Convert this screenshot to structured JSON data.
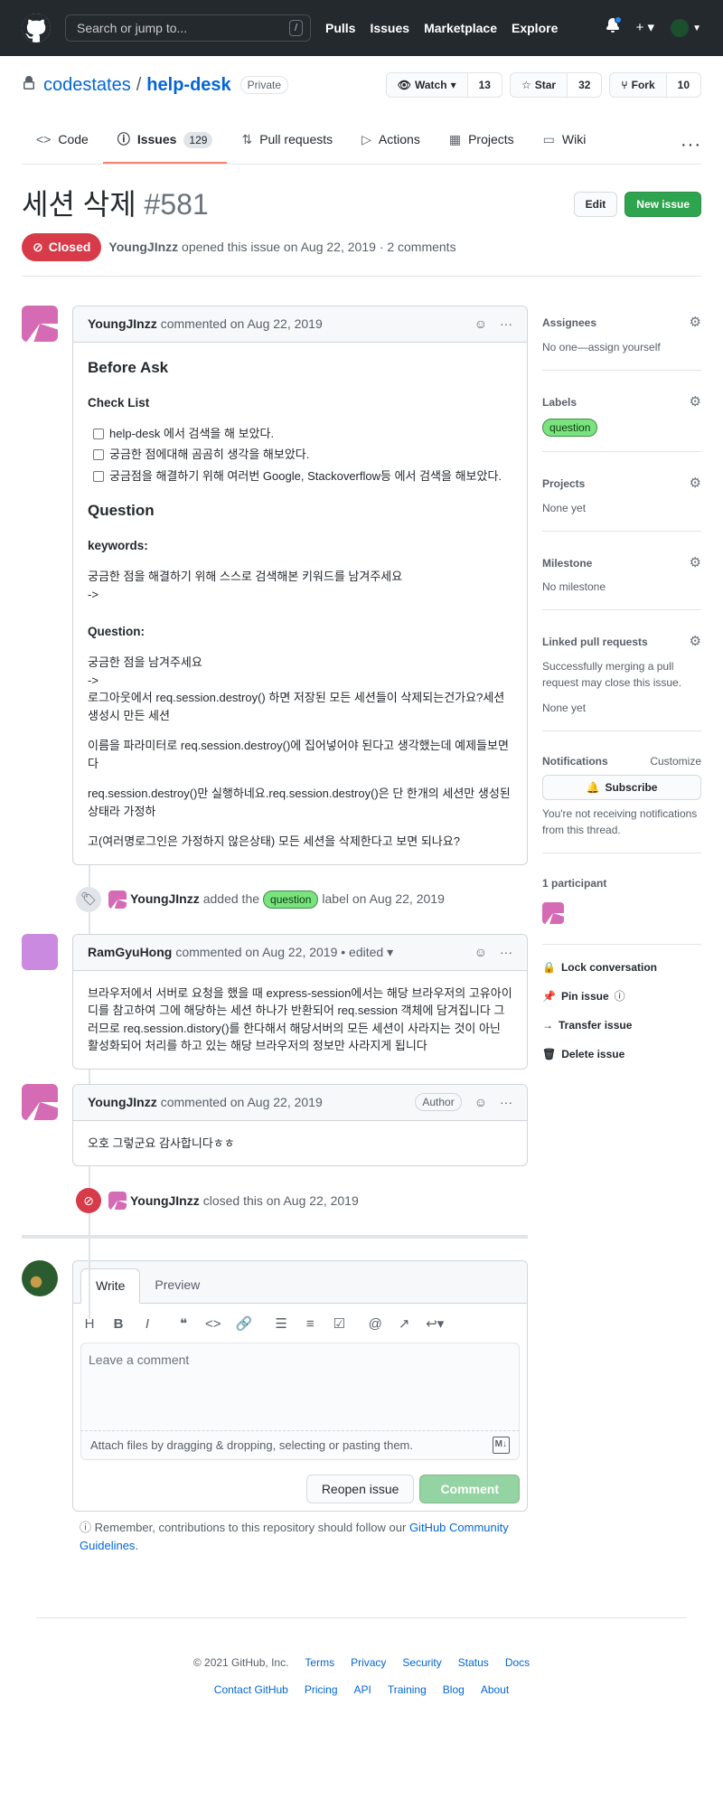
{
  "header": {
    "search_placeholder": "Search or jump to...",
    "slash": "/",
    "nav": [
      "Pulls",
      "Issues",
      "Marketplace",
      "Explore"
    ],
    "plus": "+ ▾"
  },
  "repo": {
    "owner": "codestates",
    "sep": "/",
    "name": "help-desk",
    "visibility": "Private",
    "watch_label": "Watch",
    "watch_count": "13",
    "star_label": "Star",
    "star_count": "32",
    "fork_label": "Fork",
    "fork_count": "10"
  },
  "tabs": [
    {
      "label": "Code",
      "icon": "code-icon"
    },
    {
      "label": "Issues",
      "icon": "issue-icon",
      "count": "129"
    },
    {
      "label": "Pull requests",
      "icon": "pull-request-icon"
    },
    {
      "label": "Actions",
      "icon": "play-icon"
    },
    {
      "label": "Projects",
      "icon": "project-icon"
    },
    {
      "label": "Wiki",
      "icon": "book-icon"
    }
  ],
  "issue": {
    "title": "세션 삭제",
    "number": "#581",
    "edit_label": "Edit",
    "new_issue_label": "New issue",
    "state": "Closed",
    "author": "YoungJInzz",
    "meta_text": "opened this issue on Aug 22, 2019 · 2 comments"
  },
  "comments": [
    {
      "author": "YoungJInzz",
      "meta": "commented on Aug 22, 2019",
      "body": {
        "h_before": "Before Ask",
        "h_checklist": "Check List",
        "checklist": [
          "help-desk 에서 검색을 해 보았다.",
          "궁금한 점에대해 곰곰히 생각을 해보았다.",
          "궁금점을 해결하기 위해 여러번 Google, Stackoverflow등 에서 검색을 해보았다."
        ],
        "h_question": "Question",
        "h_keywords": "keywords:",
        "keywords_text": "궁금한 점을 해결하기 위해 스스로 검색해본 키워드를 남겨주세요",
        "keywords_arrow": "->",
        "h_question2": "Question:",
        "q_line1": "궁금한 점을 남겨주세요",
        "q_arrow": "->",
        "q_line2": "로그아웃에서 req.session.destroy() 하면 저장된 모든 세션들이 삭제되는건가요?세션생성시 만든 세션",
        "p1": "이름을 파라미터로 req.session.destroy()에 집어넣어야 된다고 생각했는데 예제들보면 다",
        "p2": "req.session.destroy()만 실행하네요.req.session.destroy()은 단 한개의 세션만 생성된 상태라 가정하",
        "p3": "고(여러명로그인은 가정하지 않은상태) 모든 세션을 삭제한다고 보면 되나요?"
      }
    },
    {
      "author": "RamGyuHong",
      "meta": "commented on Aug 22, 2019 • edited ▾",
      "body": "브라우저에서 서버로 요청을 했을 때 express-session에서는 해당 브라우저의 고유아이디를 참고하여 그에 해당하는 세션 하나가 반환되어 req.session 객체에 담겨집니다 그러므로 req.session.distory()를 한다해서 해당서버의 모든 세션이 사라지는 것이 아닌 활성화되어 처리를 하고 있는 해당 브라우저의 정보만 사라지게 됩니다"
    },
    {
      "author": "YoungJInzz",
      "meta": "commented on Aug 22, 2019",
      "badge": "Author",
      "body": "오호 그렇군요 감사합니다ㅎㅎ"
    }
  ],
  "events": {
    "label_event": {
      "actor": "YoungJInzz",
      "pre": "added the",
      "label": "question",
      "post": "label on Aug 22, 2019"
    },
    "close_event": {
      "actor": "YoungJInzz",
      "text": "closed this on Aug 22, 2019"
    }
  },
  "composer": {
    "write_tab": "Write",
    "preview_tab": "Preview",
    "placeholder": "Leave a comment",
    "attach_text": "Attach files by dragging & dropping, selecting or pasting them.",
    "md": "M↓",
    "reopen_label": "Reopen issue",
    "comment_label": "Comment",
    "remember_pre": "Remember, contributions to this repository should follow our",
    "remember_link": "GitHub Community Guidelines",
    "remember_post": "."
  },
  "sidebar": {
    "assignees_title": "Assignees",
    "assignees_text": "No one—assign yourself",
    "labels_title": "Labels",
    "label": "question",
    "projects_title": "Projects",
    "projects_text": "None yet",
    "milestone_title": "Milestone",
    "milestone_text": "No milestone",
    "linked_title": "Linked pull requests",
    "linked_text": "Successfully merging a pull request may close this issue.",
    "linked_none": "None yet",
    "notifications_title": "Notifications",
    "customize": "Customize",
    "subscribe": "Subscribe",
    "notif_text": "You're not receiving notifications from this thread.",
    "participants_title": "1 participant",
    "lock": "Lock conversation",
    "pin": "Pin issue",
    "transfer": "Transfer issue",
    "delete": "Delete issue"
  },
  "footer": {
    "copy": "© 2021 GitHub, Inc.",
    "row1": [
      "Terms",
      "Privacy",
      "Security",
      "Status",
      "Docs"
    ],
    "row2": [
      "Contact GitHub",
      "Pricing",
      "API",
      "Training",
      "Blog",
      "About"
    ]
  },
  "colors": {
    "header_bg": "#24292e",
    "closed_red": "#d73a49",
    "green": "#2ea44f",
    "link": "#0366d6",
    "label_green": "#7ae37f"
  }
}
